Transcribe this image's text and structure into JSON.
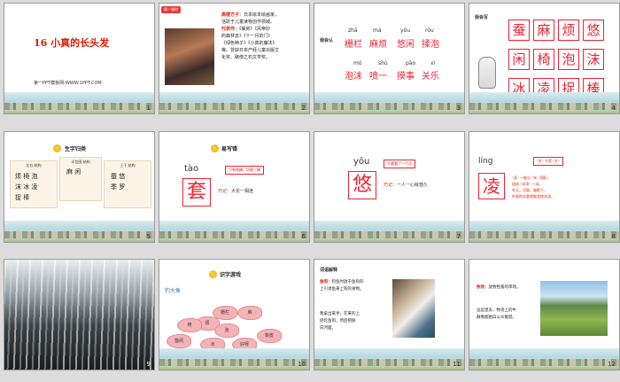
{
  "slides": [
    {
      "num": "1",
      "title": "16 小真的长头发",
      "sub": "第一PPT模板网-WWW.1PPT.COM"
    },
    {
      "num": "2",
      "tag": "第一课时",
      "heading": "高楼方子",
      "body1": "：日本绘本绘画家，",
      "body2": "活跃于儿童读物创作领域。",
      "rep_label": "代表作",
      "rep1": "：《躲房》《风帝妙",
      "rep2": "的森林去》《十一月的门》",
      "rep3": "《绿色种子》《小真的魔法》",
      "rep4": "等。曾获日本产经儿童出版文",
      "rep5": "化奖、路傍之石文学奖。"
    },
    {
      "num": "3",
      "label": "我会认",
      "pinyin": [
        "zhā",
        "má",
        "yǒu",
        "róu",
        "mó",
        "shù",
        "pāo",
        "xì"
      ],
      "row1": [
        "栅栏",
        "麻烦",
        "悠闲",
        "揉泡"
      ],
      "row2": [
        "泡沫",
        "喷一",
        "摸事",
        "关乐"
      ]
    },
    {
      "num": "4",
      "label": "我会写",
      "chars": [
        "蚕",
        "麻",
        "烦",
        "悠",
        "闲",
        "椅",
        "泡",
        "沫",
        "冰",
        "凌",
        "捉",
        "棒"
      ]
    },
    {
      "num": "5",
      "title": "生字归类",
      "groups": [
        {
          "head": "左右 结构",
          "chars": [
            "烦",
            "椅",
            "泡",
            "沫",
            "冰",
            "凌",
            "捉",
            "棒"
          ]
        },
        {
          "head": "半包围 结构",
          "chars": [
            "麻",
            "闲"
          ]
        },
        {
          "head": "上下 结构",
          "chars": [
            "蚕",
            "悠",
            "季",
            "罗"
          ]
        }
      ]
    },
    {
      "num": "6",
      "title": "易写错",
      "pinyin": "tào",
      "char": "套",
      "note": "只有两横，切莫三横",
      "tip_label": "巧记：",
      "tip": "大长一相连"
    },
    {
      "num": "7",
      "pinyin": "yōu",
      "char": "悠",
      "note": "不要看了一个点",
      "tip_label": "巧记：",
      "tip": "一人一心就悠久"
    },
    {
      "num": "8",
      "pinyin": "líng",
      "char": "凌",
      "note": "\"夊\" 不是 \"文\"",
      "t1": "\"凌\" 一般与 \"冰\" 搭配，",
      "t2": "组成 \"冰凌\" 一词。",
      "t3": "冬天，河面、屋檐下，",
      "t4": "外面的水管就能会结冰凌。"
    },
    {
      "num": "9"
    },
    {
      "num": "10",
      "title": "识字游戏",
      "subtitle": "钓大鱼",
      "fish": [
        "烦",
        "栅栏",
        "麻",
        "泡",
        "悠闲",
        "冰",
        "好呀",
        "象皮",
        "椅"
      ]
    },
    {
      "num": "11",
      "label": "词语解释",
      "term": "鱼饵：",
      "d1": "钓鱼时放于鱼钩的",
      "d2": "上引诱鱼来上钩的食物。",
      "p1": "我拿出来手，在来钓上",
      "p2": "捉吃鱼饵，然后把脱",
      "p3": "向河面。"
    },
    {
      "num": "12",
      "term": "牧场：",
      "d1": "放牧牲畜的草场。",
      "p1": "远远望去，牧场上的牛",
      "p2": "群像图图白公众散游。"
    }
  ]
}
